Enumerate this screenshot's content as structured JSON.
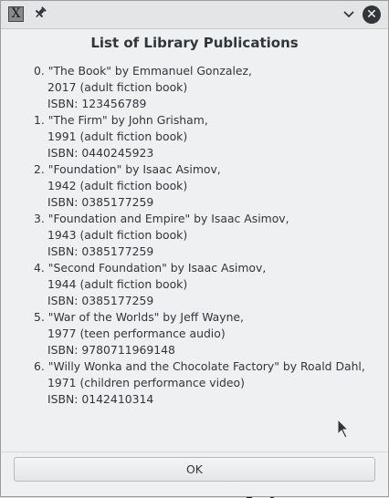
{
  "window": {
    "app_icon_glyph": "X",
    "pin_icon": "pin-icon",
    "minimize_icon": "chevron-down-icon",
    "close_icon": "close-icon",
    "close_glyph": "✕"
  },
  "dialog": {
    "heading": "List of Library Publications",
    "publications": [
      {
        "line1": "0. \"The Book\" by Emmanuel Gonzalez,",
        "line2": "2017 (adult fiction book)",
        "line3": "ISBN: 123456789"
      },
      {
        "line1": "1. \"The Firm\" by John Grisham,",
        "line2": "1991 (adult fiction book)",
        "line3": "ISBN: 0440245923"
      },
      {
        "line1": "2. \"Foundation\" by Isaac Asimov,",
        "line2": "1942 (adult fiction book)",
        "line3": "ISBN: 0385177259"
      },
      {
        "line1": "3. \"Foundation and Empire\" by Isaac Asimov,",
        "line2": "1943 (adult fiction book)",
        "line3": "ISBN: 0385177259"
      },
      {
        "line1": "4. \"Second Foundation\" by Isaac Asimov,",
        "line2": "1944 (adult fiction book)",
        "line3": "ISBN: 0385177259"
      },
      {
        "line1": "5. \"War of the Worlds\" by Jeff Wayne,",
        "line2": "1977 (teen performance audio)",
        "line3": "ISBN: 9780711969148"
      },
      {
        "line1": "6. \"Willy Wonka and the Chocolate Factory\" by Roald Dahl,",
        "line2": "1971 (children performance video)",
        "line3": "ISBN: 0142410314"
      }
    ],
    "ok_label": "OK"
  }
}
